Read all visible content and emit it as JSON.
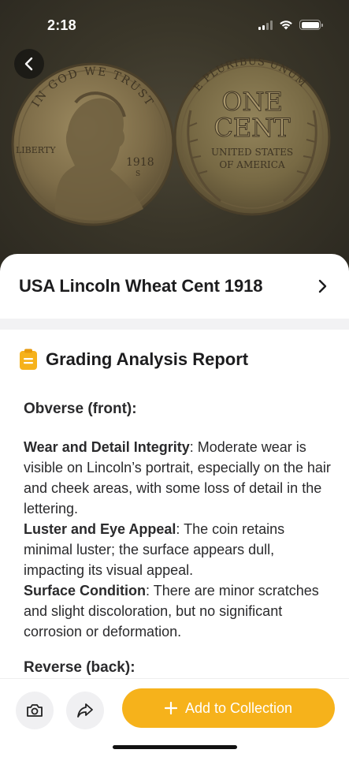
{
  "status_bar": {
    "time": "2:18",
    "icons": [
      "cellular-signal-icon",
      "wifi-icon",
      "battery-icon"
    ]
  },
  "hero": {
    "back_icon": "chevron-left-icon",
    "obverse_coin": {
      "top_legend": "IN GOD WE TRUST",
      "side_legend": "LIBERTY",
      "year": "1918",
      "mint_mark": "S"
    },
    "reverse_coin": {
      "top_legend": "E PLURIBUS UNUM",
      "denomination_line1": "ONE",
      "denomination_line2": "CENT",
      "country_line1": "UNITED STATES",
      "country_line2": "OF AMERICA"
    }
  },
  "coin": {
    "title": "USA Lincoln Wheat Cent 1918",
    "chevron_icon": "chevron-right-icon"
  },
  "report": {
    "icon": "clipboard-icon",
    "title": "Grading Analysis Report",
    "obverse_heading": "Obverse (front):",
    "items": [
      {
        "label": "Wear and Detail Integrity",
        "text": ": Moderate wear is visible on Lincoln’s portrait, especially on the hair and cheek areas, with some loss of detail in the lettering."
      },
      {
        "label": "Luster and Eye Appeal",
        "text": ": The coin retains minimal luster; the surface appears dull, impacting its visual appeal."
      },
      {
        "label": "Surface Condition",
        "text": ": There are minor scratches and slight discoloration, but no significant corrosion or deformation."
      }
    ],
    "reverse_heading": "Reverse (back):"
  },
  "bottom_bar": {
    "camera_icon": "camera-icon",
    "share_icon": "share-icon",
    "add_icon": "plus-icon",
    "add_label": "Add to Collection"
  },
  "colors": {
    "accent": "#f6b21b",
    "hero_background": "#3a3629",
    "coin_copper": "#8a7a55"
  }
}
